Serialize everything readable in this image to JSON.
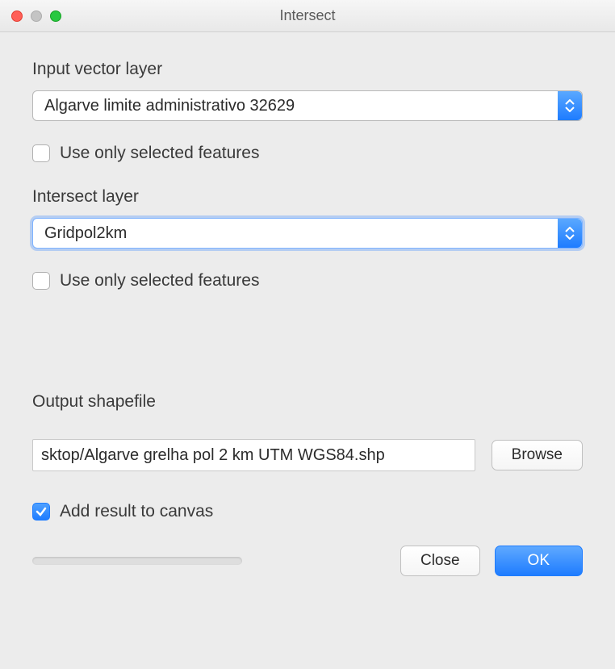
{
  "window": {
    "title": "Intersect"
  },
  "input_layer": {
    "label": "Input vector layer",
    "value": "Algarve limite administrativo 32629",
    "use_selected_label": "Use only selected features",
    "use_selected_checked": false
  },
  "intersect_layer": {
    "label": "Intersect layer",
    "value": "Gridpol2km",
    "use_selected_label": "Use only selected features",
    "use_selected_checked": false
  },
  "output": {
    "label": "Output shapefile",
    "value": "sktop/Algarve grelha pol 2 km UTM WGS84.shp",
    "browse_label": "Browse"
  },
  "add_to_canvas": {
    "label": "Add result to canvas",
    "checked": true
  },
  "buttons": {
    "close": "Close",
    "ok": "OK"
  }
}
